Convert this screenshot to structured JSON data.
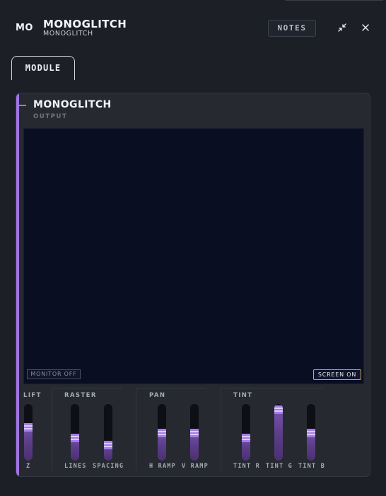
{
  "header": {
    "abbr": "MO",
    "title": "MONOGLITCH",
    "subtitle": "MONOGLITCH",
    "notes_label": "NOTES",
    "collapse_icon": "collapse-arrows-icon",
    "close_icon": "close-icon"
  },
  "tabs": [
    {
      "label": "MODULE",
      "active": true
    }
  ],
  "module": {
    "title": "MONOGLITCH",
    "subtitle": "OUTPUT",
    "accent_color": "#a274e6",
    "screen": {
      "monitor_label": "MONITOR OFF",
      "screen_label": "SCREEN ON"
    },
    "groups": [
      {
        "label": "LIFT",
        "sliders": [
          {
            "label": "Z",
            "value": 0.6
          }
        ]
      },
      {
        "label": "RASTER",
        "sliders": [
          {
            "label": "LINES",
            "value": 0.38
          },
          {
            "label": "SPACING",
            "value": 0.24
          }
        ]
      },
      {
        "label": "PAN",
        "sliders": [
          {
            "label": "H RAMP",
            "value": 0.48
          },
          {
            "label": "V RAMP",
            "value": 0.48
          }
        ]
      },
      {
        "label": "TINT",
        "sliders": [
          {
            "label": "TINT R",
            "value": 0.38
          },
          {
            "label": "TINT G",
            "value": 0.97
          },
          {
            "label": "TINT B",
            "value": 0.48
          }
        ]
      }
    ]
  }
}
